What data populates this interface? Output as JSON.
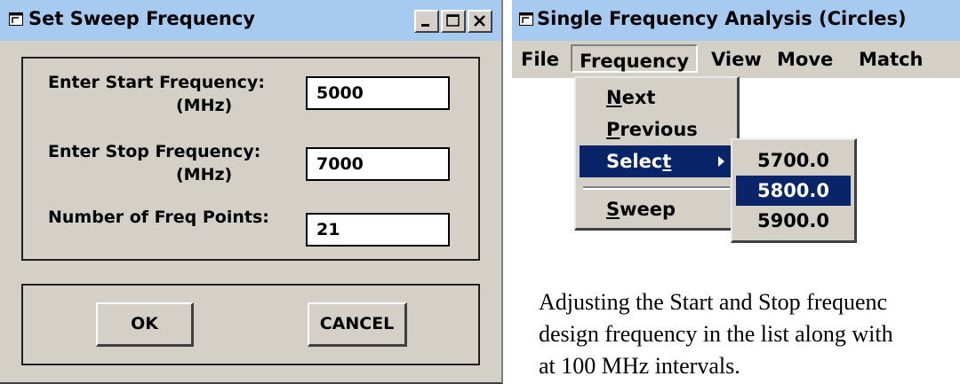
{
  "sweep_dialog": {
    "title": "Set Sweep Frequency",
    "start_label": "Enter Start Frequency:",
    "start_unit": "(MHz)",
    "start_value": "5000",
    "stop_label": "Enter Stop Frequency:",
    "stop_unit": "(MHz)",
    "stop_value": "7000",
    "points_label": "Number of Freq Points:",
    "points_value": "21",
    "ok_label": "OK",
    "cancel_label": "CANCEL",
    "window_buttons": [
      "minimize-icon",
      "maximize-icon",
      "close-icon"
    ]
  },
  "analysis_window": {
    "title": "Single Frequency Analysis (Circles)",
    "menus": [
      "File",
      "Frequency",
      "View",
      "Move",
      "Match"
    ],
    "frequency_menu": [
      {
        "label": "Next",
        "mnemonic": "N"
      },
      {
        "label": "Previous",
        "mnemonic": "P"
      },
      {
        "label": "Select",
        "mnemonic": "t",
        "highlighted": true,
        "has_submenu": true
      },
      {
        "label": "Sweep",
        "mnemonic": "S"
      }
    ],
    "select_submenu": [
      {
        "label": "5700.0"
      },
      {
        "label": "5800.0",
        "highlighted": true
      },
      {
        "label": "5900.0"
      }
    ]
  },
  "caption_lines": [
    "Adjusting the Start and Stop frequenc",
    "design frequency in the list along with",
    "at 100 MHz intervals."
  ],
  "colors": {
    "titlebar": "#a6caf0",
    "face": "#d4d0c8",
    "highlight": "#0a246a"
  }
}
